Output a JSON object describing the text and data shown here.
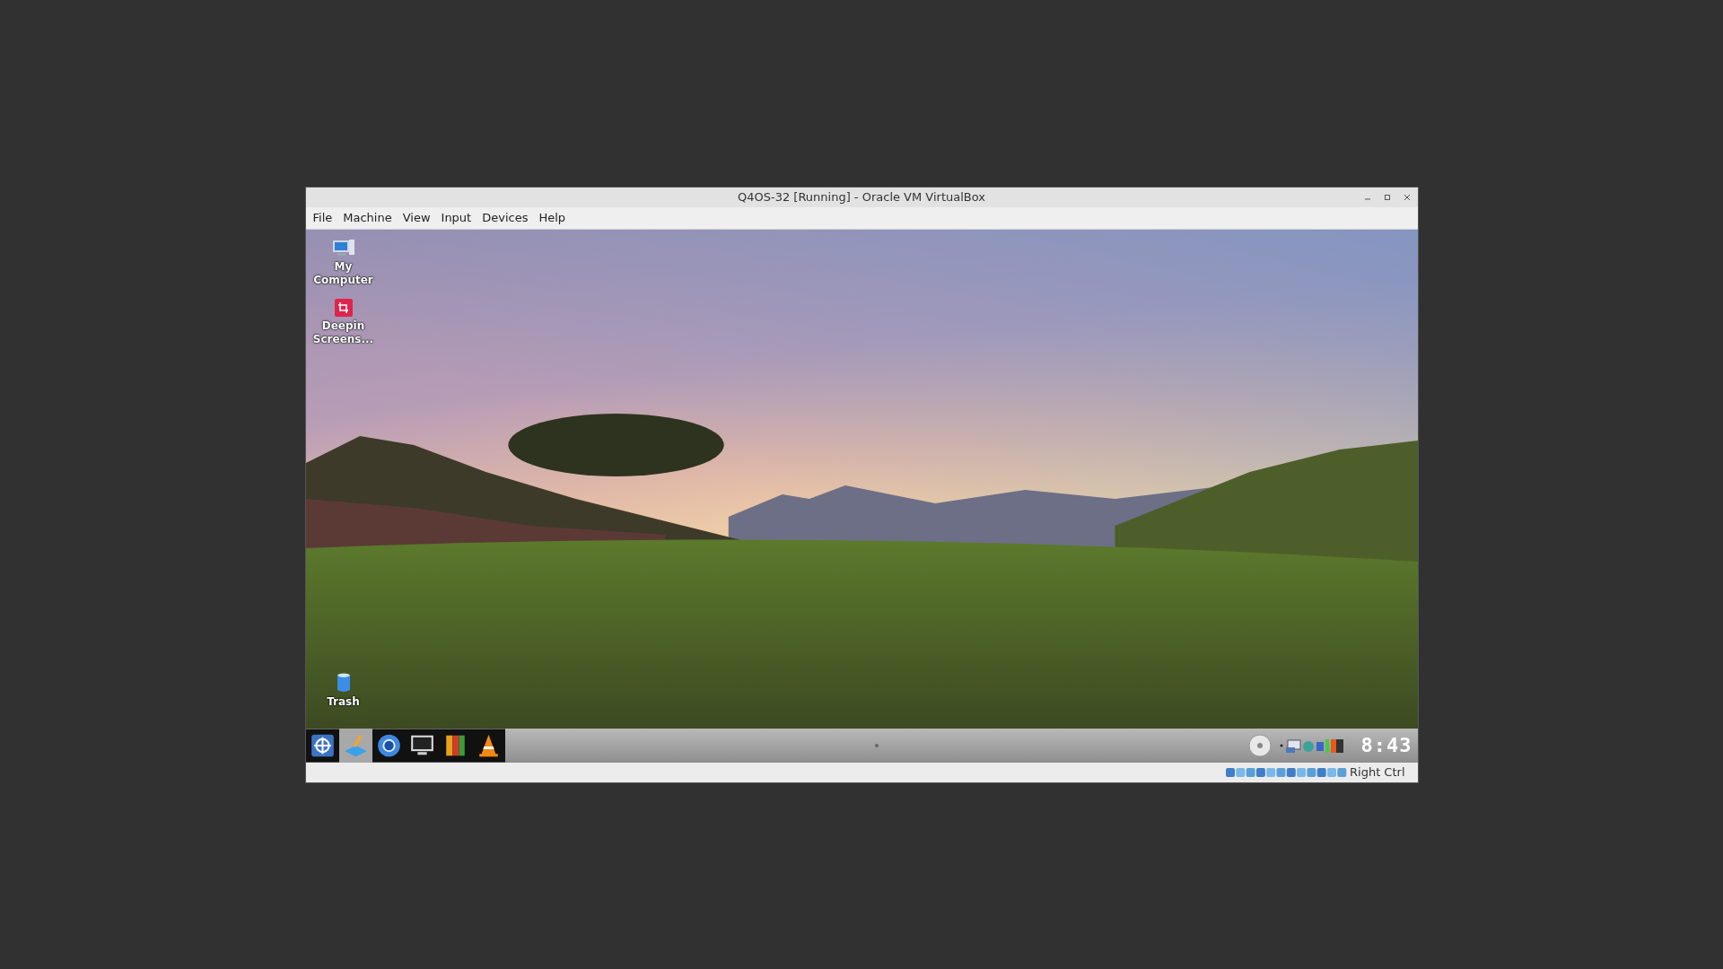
{
  "window": {
    "title": "Q4OS-32 [Running] - Oracle VM VirtualBox"
  },
  "menu": [
    "File",
    "Machine",
    "View",
    "Input",
    "Devices",
    "Help"
  ],
  "desktop_icons": [
    {
      "kind": "computer",
      "label": "My Computer"
    },
    {
      "kind": "screenshot",
      "label": "Deepin Screens..."
    },
    {
      "kind": "trash",
      "label": "Trash"
    }
  ],
  "taskbar": {
    "clock": "8:43"
  },
  "status_bar": {
    "host_key": "Right Ctrl"
  }
}
